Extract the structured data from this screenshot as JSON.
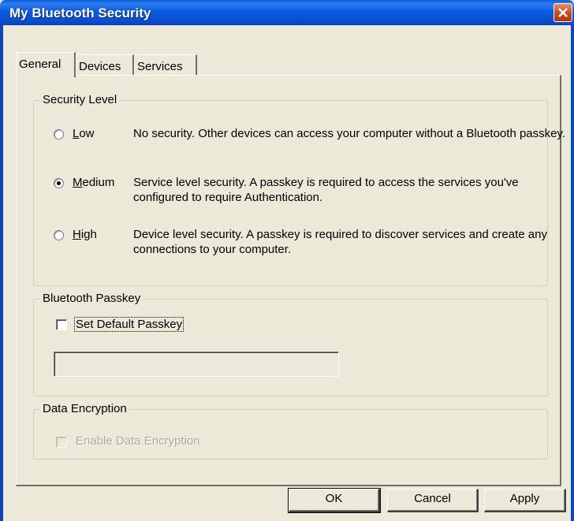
{
  "window": {
    "title": "My Bluetooth Security"
  },
  "tabs": [
    {
      "label": "General",
      "active": true
    },
    {
      "label": "Devices",
      "active": false
    },
    {
      "label": "Services",
      "active": false
    }
  ],
  "security_level": {
    "group_label": "Security Level",
    "options": [
      {
        "label": "Low",
        "mnemonic": "L",
        "description": "No security. Other devices can access your computer without a Bluetooth passkey.",
        "checked": false
      },
      {
        "label": "Medium",
        "mnemonic": "M",
        "description": "Service level security. A passkey is required to access the services you've configured to require Authentication.",
        "checked": true
      },
      {
        "label": "High",
        "mnemonic": "H",
        "description": "Device level security. A passkey is required to discover services and create any connections to your computer.",
        "checked": false
      }
    ]
  },
  "passkey": {
    "group_label": "Bluetooth Passkey",
    "checkbox_label": "Set Default Passkey",
    "checkbox_checked": false,
    "field_value": ""
  },
  "encryption": {
    "group_label": "Data Encryption",
    "checkbox_label": "Enable Data Encryption",
    "checkbox_checked": false,
    "enabled": false
  },
  "buttons": {
    "ok": "OK",
    "cancel": "Cancel",
    "apply": "Apply"
  }
}
